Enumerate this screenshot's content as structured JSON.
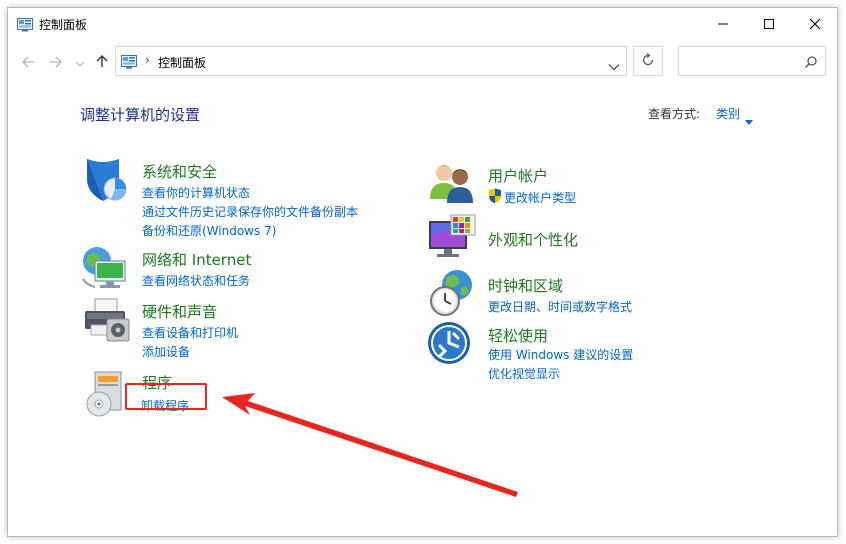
{
  "window": {
    "title": "控制面板"
  },
  "address": {
    "crumb": "控制面板",
    "separator": "›",
    "search_placeholder": ""
  },
  "content": {
    "heading": "调整计算机的设置",
    "view_by_label": "查看方式:",
    "view_by_value": "类别"
  },
  "categories": [
    {
      "title": "系统和安全",
      "links": [
        "查看你的计算机状态",
        "通过文件历史记录保存你的文件备份副本",
        "备份和还原(Windows 7)"
      ]
    },
    {
      "title": "网络和 Internet",
      "links": [
        "查看网络状态和任务"
      ]
    },
    {
      "title": "硬件和声音",
      "links": [
        "查看设备和打印机",
        "添加设备"
      ]
    },
    {
      "title": "程序",
      "links": [
        "卸载程序"
      ]
    },
    {
      "title": "用户帐户",
      "links": [
        "更改帐户类型"
      ]
    },
    {
      "title": "外观和个性化",
      "links": []
    },
    {
      "title": "时钟和区域",
      "links": [
        "更改日期、时间或数字格式"
      ]
    },
    {
      "title": "轻松使用",
      "links": [
        "使用 Windows 建议的设置",
        "优化视觉显示"
      ]
    }
  ],
  "colors": {
    "heading": "#1e3287",
    "category_title": "#1e7a1e",
    "link": "#0066cc",
    "annotation": "#e8251f"
  },
  "icons": {
    "window": "control-panel-icon",
    "back": "arrow-left-icon",
    "forward": "arrow-right-icon",
    "up": "arrow-up-icon",
    "refresh": "refresh-icon",
    "search": "search-icon"
  }
}
